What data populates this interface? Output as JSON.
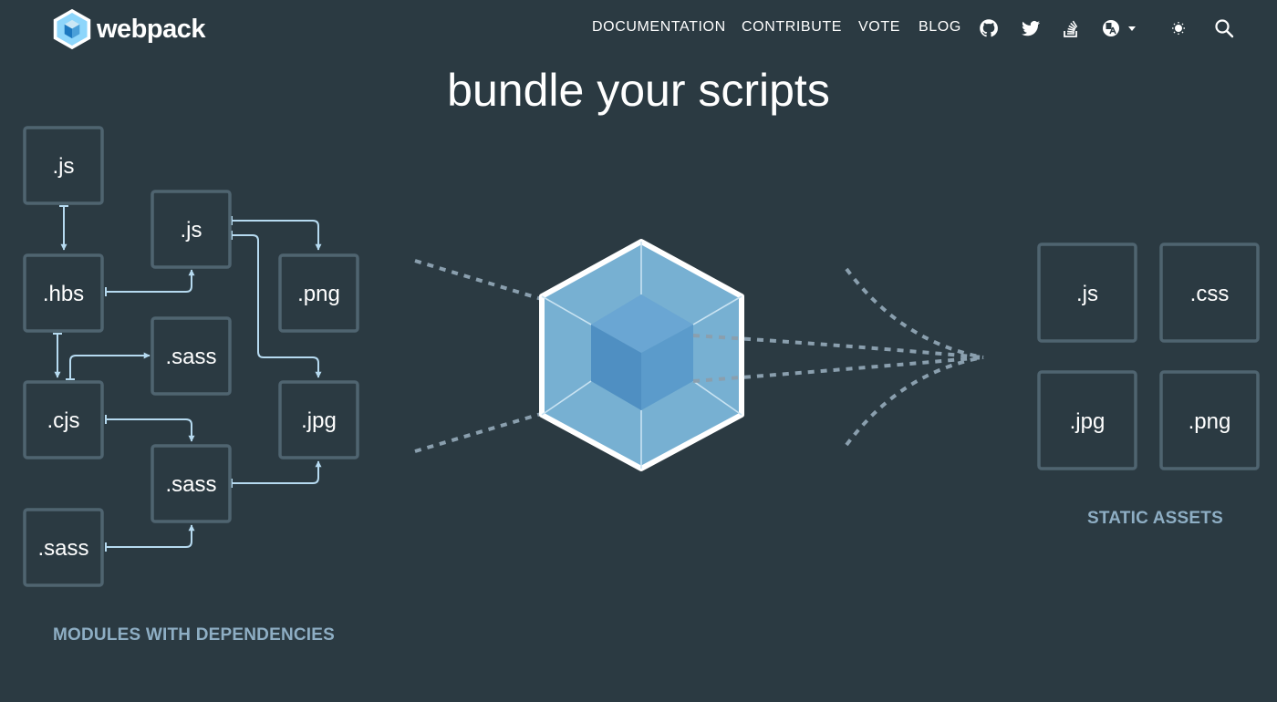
{
  "header": {
    "brand": "webpack",
    "nav": [
      {
        "label": "DOCUMENTATION"
      },
      {
        "label": "CONTRIBUTE"
      },
      {
        "label": "VOTE"
      },
      {
        "label": "BLOG"
      }
    ],
    "icons": [
      "github-icon",
      "twitter-icon",
      "stackoverflow-icon",
      "language-icon",
      "theme-toggle-icon",
      "search-icon"
    ]
  },
  "hero": {
    "title": "bundle your scripts"
  },
  "diagram": {
    "modules": [
      ".js",
      ".js",
      ".hbs",
      ".png",
      ".sass",
      ".cjs",
      ".jpg",
      ".sass",
      ".sass"
    ],
    "assets": [
      ".js",
      ".css",
      ".jpg",
      ".png"
    ],
    "modules_caption": "MODULES WITH DEPENDENCIES",
    "assets_caption": "STATIC ASSETS"
  },
  "colors": {
    "background": "#2b3a42",
    "box_border": "#4f6470",
    "arrow": "#b6daf0",
    "caption": "#8eaec4",
    "dashes": "#8a9fae",
    "cube_outer": "#7fb4d6",
    "cube_inner": "#5598c9"
  }
}
